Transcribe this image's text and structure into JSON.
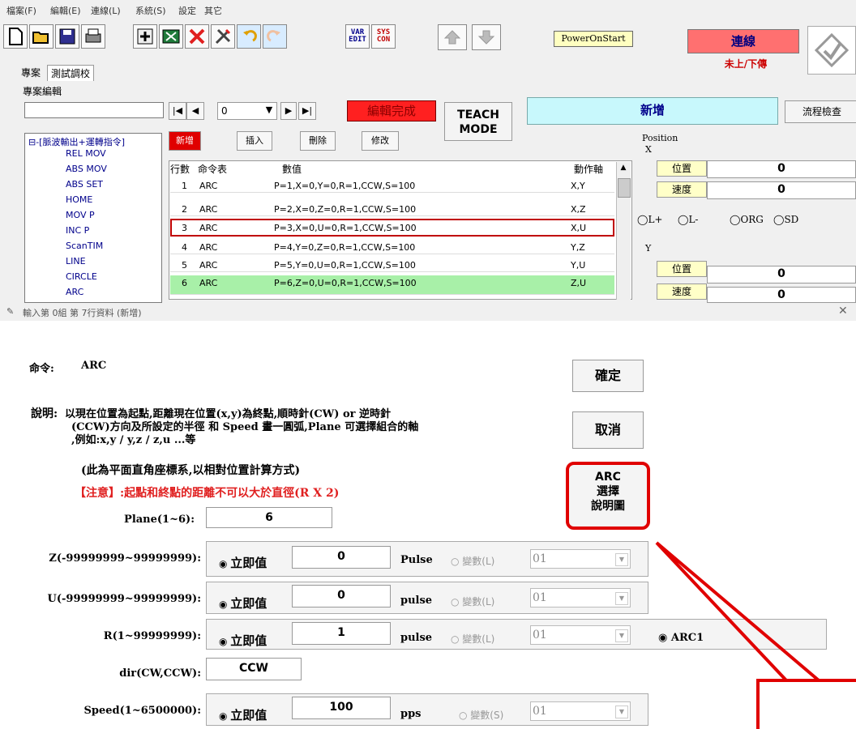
{
  "menu": [
    "檔案(F)",
    "編輯(E)",
    "連線(L)",
    "系統(S)",
    "設定",
    "其它"
  ],
  "toolbar": {
    "var_edit_label": "VAR EDIT",
    "sys_con_label": "SYS CON",
    "poweron": "PowerOnStart",
    "connect_label": "連線",
    "connect_status": "未上/下傳"
  },
  "tabs": [
    "專案",
    "測試調校"
  ],
  "project_group": "專案編輯",
  "nav": {
    "value": "0"
  },
  "edit_done": "編輯完成",
  "teach_mode": "TEACH MODE",
  "new_label": "新增",
  "flow_check": "流程檢查",
  "tree": {
    "root": "⊟-[脈波輸出+運轉指令]",
    "items": [
      "REL MOV",
      "ABS MOV",
      "ABS SET",
      "HOME",
      "MOV P",
      "INC P",
      "ScanTIM",
      "LINE",
      "CIRCLE",
      "ARC"
    ]
  },
  "actions": {
    "new": "新增",
    "insert": "插入",
    "delete": "刪除",
    "modify": "修改"
  },
  "table": {
    "headers": [
      "行數",
      "命令表",
      "數值",
      "動作軸"
    ],
    "rows": [
      {
        "n": "1",
        "cmd": "ARC",
        "val": "P=1,X=0,Y=0,R=1,CCW,S=100",
        "axis": "X,Y"
      },
      {
        "n": "2",
        "cmd": "ARC",
        "val": "P=2,X=0,Z=0,R=1,CCW,S=100",
        "axis": "X,Z"
      },
      {
        "n": "3",
        "cmd": "ARC",
        "val": "P=3,X=0,U=0,R=1,CCW,S=100",
        "axis": "X,U"
      },
      {
        "n": "4",
        "cmd": "ARC",
        "val": "P=4,Y=0,Z=0,R=1,CCW,S=100",
        "axis": "Y,Z"
      },
      {
        "n": "5",
        "cmd": "ARC",
        "val": "P=5,Y=0,U=0,R=1,CCW,S=100",
        "axis": "Y,U"
      },
      {
        "n": "6",
        "cmd": "ARC",
        "val": "P=6,Z=0,U=0,R=1,CCW,S=100",
        "axis": "Z,U"
      }
    ]
  },
  "position": {
    "title": "Position",
    "x_label": "X",
    "y_label": "Y",
    "pos_label": "位置",
    "speed_label": "速度",
    "x_pos": "0",
    "x_speed": "0",
    "y_pos": "0",
    "y_speed": "0",
    "radios": [
      "L+",
      "L-",
      "ORG",
      "SD"
    ]
  },
  "dialog": {
    "title": "輸入第 0組 第 7行資料 (新增)",
    "command_label": "命令:",
    "command": "ARC",
    "desc_label": "說明:",
    "desc_line1": "以現在位置為起點,距離現在位置(x,y)為終點,順時針(CW) or 逆時針",
    "desc_line2": "(CCW)方向及所設定的半徑 和 Speed 畫一圓弧,Plane 可選擇組合的軸",
    "desc_line3": ",例如:x,y / y,z / z,u ...等",
    "note1": "(此為平面直角座標系,以相對位置計算方式)",
    "note2": "【注意】:起點和終點的距離不可以大於直徑(R X 2)",
    "ok": "確定",
    "cancel": "取消",
    "arc_help_line1": "ARC",
    "arc_help_line2": "選擇",
    "arc_help_line3": "說明圖",
    "plane_label": "Plane(1~6):",
    "plane_value": "6",
    "z_label": "Z(-99999999~99999999):",
    "z_value": "0",
    "z_unit": "Pulse",
    "u_label": "U(-99999999~99999999):",
    "u_value": "0",
    "u_unit": "pulse",
    "r_label": "R(1~99999999):",
    "r_value": "1",
    "r_unit": "pulse",
    "arc1": "ARC1",
    "dir_label": "dir(CW,CCW):",
    "dir_value": "CCW",
    "speed_label": "Speed(1~6500000):",
    "speed_value": "100",
    "speed_unit": "pps",
    "immediate": "立即值",
    "var_l": "變數(L)",
    "var_s": "變數(S)",
    "var_value": "01"
  }
}
